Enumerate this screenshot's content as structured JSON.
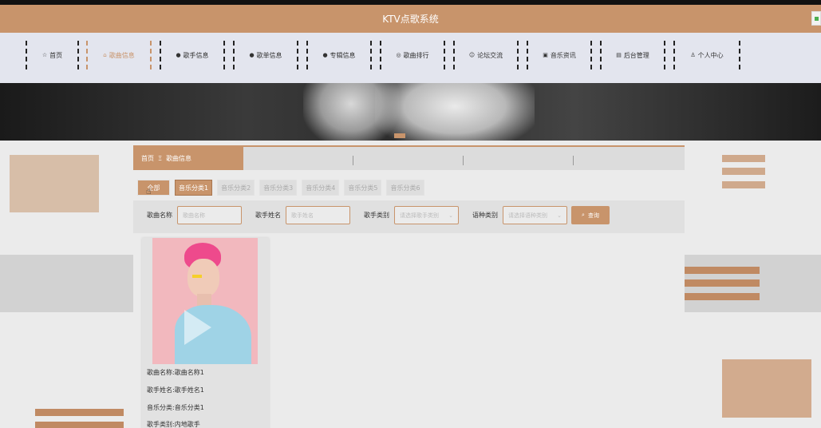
{
  "header": {
    "title": "KTV点歌系统"
  },
  "nav": {
    "items": [
      {
        "icon": "☆",
        "label": "首页"
      },
      {
        "icon": "⌂",
        "label": "歌曲信息"
      },
      {
        "icon": "●",
        "label": "歌手信息"
      },
      {
        "icon": "●",
        "label": "歌单信息"
      },
      {
        "icon": "●",
        "label": "专辑信息"
      },
      {
        "icon": "◎",
        "label": "歌曲排行"
      },
      {
        "icon": "☺",
        "label": "论坛交流"
      },
      {
        "icon": "▣",
        "label": "音乐资讯"
      },
      {
        "icon": "▤",
        "label": "后台管理"
      },
      {
        "icon": "♙",
        "label": "个人中心"
      }
    ],
    "active_index": 1
  },
  "breadcrumb": {
    "home": "首页",
    "separator": "Ξ",
    "current": "歌曲信息"
  },
  "categories": [
    "全部",
    "音乐分类1",
    "音乐分类2",
    "音乐分类3",
    "音乐分类4",
    "音乐分类5",
    "音乐分类6"
  ],
  "search": {
    "song_name_label": "歌曲名称",
    "song_name_placeholder": "歌曲名称",
    "singer_name_label": "歌手姓名",
    "singer_name_placeholder": "歌手姓名",
    "singer_type_label": "歌手类别",
    "singer_type_placeholder": "请选择歌手类别",
    "language_label": "语种类别",
    "language_placeholder": "请选择语种类别",
    "query_label": "查询"
  },
  "songs": [
    {
      "line1": "歌曲名称:歌曲名称1",
      "line2": "歌手姓名:歌手姓名1",
      "line3": "音乐分类:音乐分类1",
      "line4": "歌手类别:内地歌手"
    }
  ],
  "colors": {
    "accent": "#c8946b",
    "nav_bg": "#e3e5ee",
    "page_bg": "#ebebeb"
  }
}
